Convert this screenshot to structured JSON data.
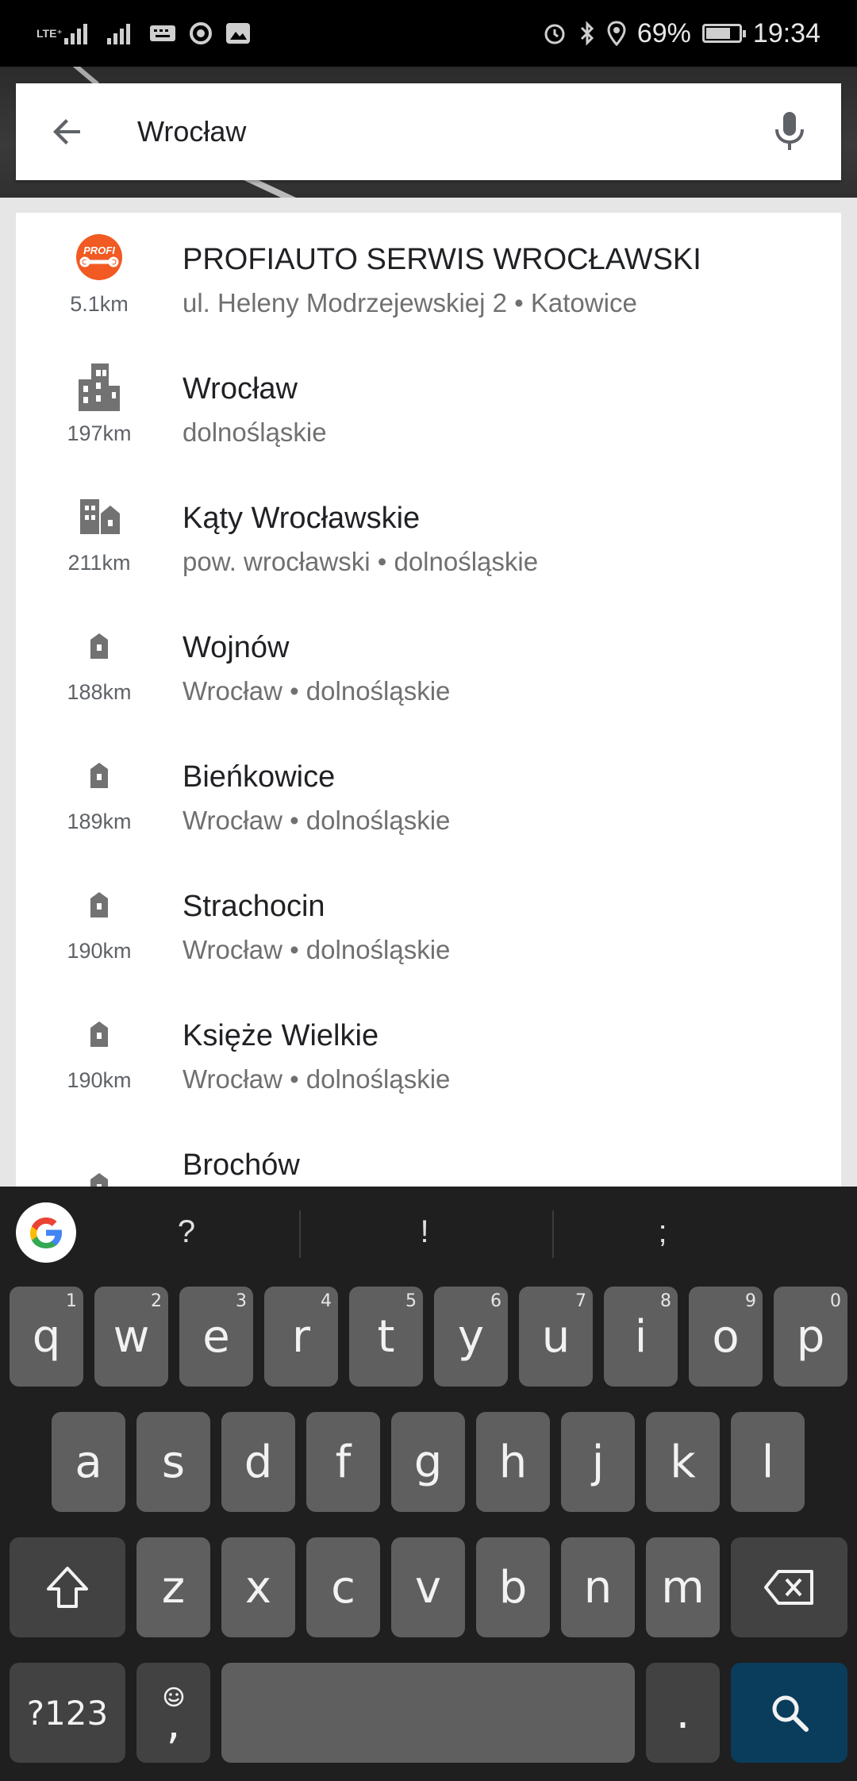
{
  "status_bar": {
    "network_label": "LTE⁺",
    "battery": "69%",
    "battery_level": 0.69,
    "time": "19:34"
  },
  "search": {
    "query": "Wrocław",
    "back_icon": "arrow-left-icon",
    "mic_icon": "mic-icon"
  },
  "results": [
    {
      "icon": "profi-logo",
      "distance": "5.1km",
      "title": "PROFIAUTO SERWIS WROCŁAWSKI",
      "subtitle": "ul. Heleny Modrzejewskiej 2 • Katowice"
    },
    {
      "icon": "city-icon",
      "distance": "197km",
      "title": "Wrocław",
      "subtitle": "dolnośląskie"
    },
    {
      "icon": "town-icon",
      "distance": "211km",
      "title": "Kąty Wrocławskie",
      "subtitle": "pow. wrocławski • dolnośląskie"
    },
    {
      "icon": "building-icon",
      "distance": "188km",
      "title": "Wojnów",
      "subtitle": "Wrocław • dolnośląskie"
    },
    {
      "icon": "building-icon",
      "distance": "189km",
      "title": "Bieńkowice",
      "subtitle": "Wrocław • dolnośląskie"
    },
    {
      "icon": "building-icon",
      "distance": "190km",
      "title": "Strachocin",
      "subtitle": "Wrocław • dolnośląskie"
    },
    {
      "icon": "building-icon",
      "distance": "190km",
      "title": "Księże Wielkie",
      "subtitle": "Wrocław • dolnośląskie"
    },
    {
      "icon": "building-icon",
      "distance": "",
      "title": "Brochów",
      "subtitle": ""
    }
  ],
  "profi_logo_text": "PROFI",
  "keyboard": {
    "suggestions": [
      "?",
      "!",
      ";"
    ],
    "row1": [
      {
        "key": "q",
        "hint": "1"
      },
      {
        "key": "w",
        "hint": "2"
      },
      {
        "key": "e",
        "hint": "3"
      },
      {
        "key": "r",
        "hint": "4"
      },
      {
        "key": "t",
        "hint": "5"
      },
      {
        "key": "y",
        "hint": "6"
      },
      {
        "key": "u",
        "hint": "7"
      },
      {
        "key": "i",
        "hint": "8"
      },
      {
        "key": "o",
        "hint": "9"
      },
      {
        "key": "p",
        "hint": "0"
      }
    ],
    "row2": [
      "a",
      "s",
      "d",
      "f",
      "g",
      "h",
      "j",
      "k",
      "l"
    ],
    "row3": [
      "z",
      "x",
      "c",
      "v",
      "b",
      "n",
      "m"
    ],
    "symbols_label": "?123",
    "comma_label": ",",
    "period_label": ".",
    "colors": {
      "key": "#5f5f5f",
      "special_key": "#424242",
      "action_key": "#0a3d5c",
      "background": "#1f1f1f"
    }
  }
}
